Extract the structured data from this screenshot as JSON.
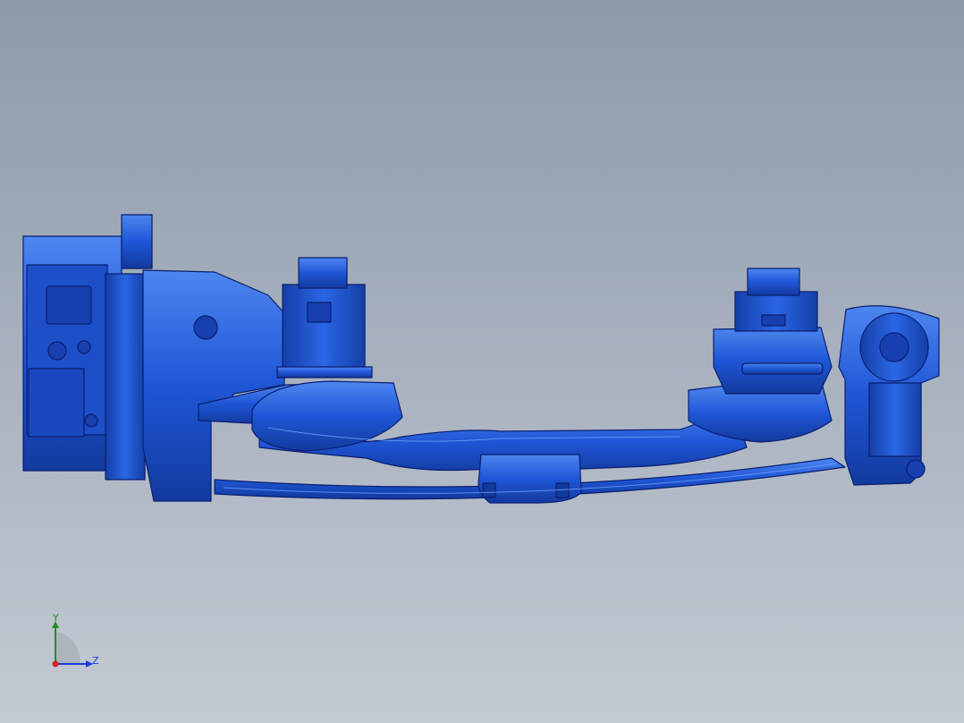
{
  "viewport": {
    "background_top": "#8b9aab",
    "background_bottom": "#c3cad3"
  },
  "model": {
    "body_color": "#1f56d6",
    "edge_color": "#0a1e6e",
    "highlight_color": "#4d86f0"
  },
  "triad": {
    "y_label": "Y",
    "z_label": "Z",
    "y_color": "#1f8f2a",
    "z_color": "#1e3ad6",
    "x_color": "#d8232a"
  }
}
